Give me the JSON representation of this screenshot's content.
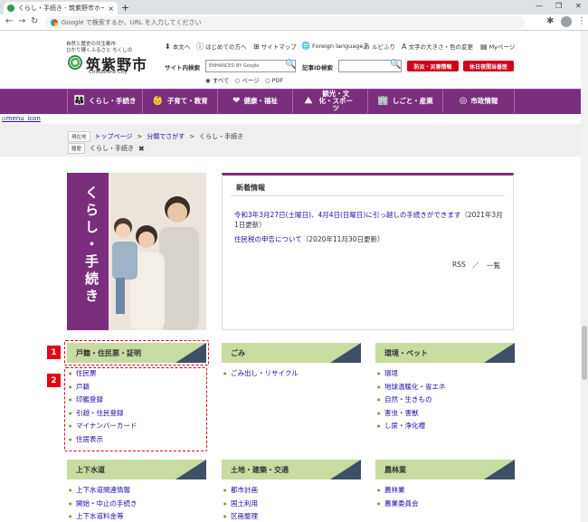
{
  "browser": {
    "tab_title": "くらし・手続き - 筑紫野市ホームペー",
    "tab_close": "×",
    "new_tab": "+",
    "win_min": "—",
    "win_max": "❐",
    "win_close": "✕",
    "back": "←",
    "forward": "→",
    "reload": "↻",
    "omnibox_placeholder": "Google で検索するか、URL を入力してください",
    "ext_icon": "✱",
    "menu_icon": "⋮"
  },
  "header": {
    "tagline_line1": "自然と歴史の共生都市",
    "tagline_line2": "ひかり輝くふるさと ちくしの",
    "logo_name": "筑紫野市",
    "logo_sub": "Chikushino City",
    "links": [
      {
        "icon": "⬇",
        "label": "本文へ"
      },
      {
        "icon": "ⓘ",
        "label": "はじめての方へ"
      },
      {
        "icon": "⊞",
        "label": "サイトマップ"
      },
      {
        "icon": "🌐",
        "label": "Foreign language"
      },
      {
        "icon": "あ",
        "label": "ルビふり"
      },
      {
        "icon": "A",
        "label": "文字の大きさ・色の変更"
      },
      {
        "icon": "▤",
        "label": "Myページ"
      }
    ],
    "site_search_label": "サイト内検索",
    "site_search_placeholder": "ENHANCED BY Google",
    "search_options": [
      "すべて",
      "ページ",
      "PDF"
    ],
    "article_id_label": "記事ID検索",
    "emergency_button": "防災・災害情報",
    "holiday_button": "休日夜間当番医"
  },
  "nav": [
    {
      "icon": "👨‍👩‍👧",
      "label": "くらし・手続き"
    },
    {
      "icon": "👶",
      "label": "子育て・教育"
    },
    {
      "icon": "❤",
      "label": "健康・福祉"
    },
    {
      "icon": "⛰",
      "label": "観光・文化・スポーツ"
    },
    {
      "icon": "🏢",
      "label": "しごと・産業"
    },
    {
      "icon": "◎",
      "label": "市政情報"
    }
  ],
  "broken_image_alt": "menu_icon",
  "breadcrumb": {
    "current_label": "現在地",
    "home": "トップページ",
    "by_field": "分類でさがす",
    "current": "くらし・手続き",
    "history_label": "履歴",
    "history_item": "くらし・手続き",
    "close_icon": "✖"
  },
  "hero": {
    "title": "くらし・手続き"
  },
  "news": {
    "title": "新着情報",
    "items": [
      {
        "link": "令和3年3月27日(土曜日)、4月4日(日曜日)に引っ越しの手続きができます",
        "date": "（2021年3月1日更新）"
      },
      {
        "link": "住民税の申告について",
        "date": "（2020年11月30日更新）"
      }
    ],
    "rss": "RSS",
    "sep": "／",
    "all": "一覧"
  },
  "categories": [
    {
      "title": "戸籍・住民票・証明",
      "items": [
        "住民票",
        "戸籍",
        "印鑑登録",
        "引越・住民登録",
        "マイナンバーカード",
        "住居表示"
      ]
    },
    {
      "title": "ごみ",
      "items": [
        "ごみ出し・リサイクル"
      ]
    },
    {
      "title": "環境・ペット",
      "items": [
        "環境",
        "地球温暖化・省エネ",
        "自然・生きもの",
        "害虫・害獣",
        "し尿・浄化槽"
      ]
    },
    {
      "title": "上下水道",
      "items": [
        "上下水道関連情報",
        "開始・中止の手続き",
        "上下水道料金等"
      ]
    },
    {
      "title": "土地・建築・交通",
      "items": [
        "都市計画",
        "国土利用",
        "区画整理"
      ]
    },
    {
      "title": "農林業",
      "items": [
        "農林業",
        "農業委員会"
      ]
    }
  ],
  "callouts": [
    "1",
    "2"
  ],
  "colors": {
    "accent": "#7b2d7e",
    "category_green": "#c8dba0",
    "category_navy": "#3e4f68",
    "alert_red": "#e60012"
  }
}
